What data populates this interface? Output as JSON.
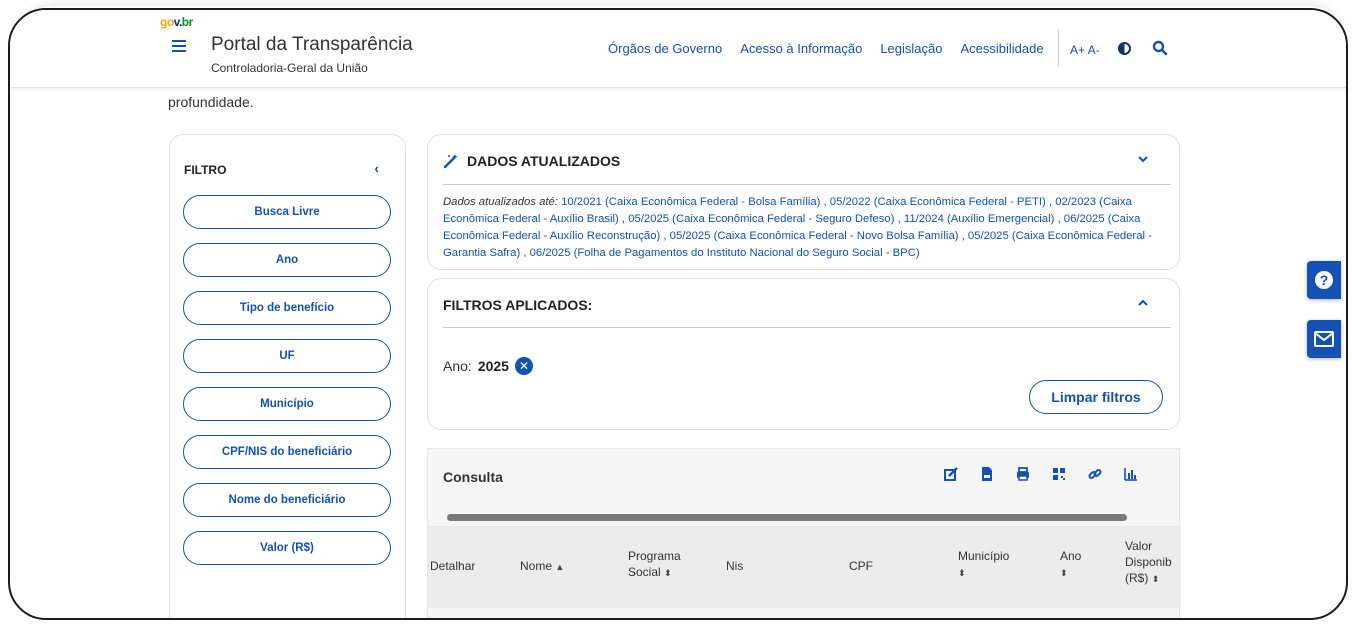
{
  "header": {
    "govbr": {
      "g1": "go",
      "g2": "v.",
      "g3": "br"
    },
    "title": "Portal da Transparência",
    "subtitle": "Controladoria-Geral da União",
    "nav": [
      "Órgãos de Governo",
      "Acesso à Informação",
      "Legislação",
      "Acessibilidade"
    ],
    "font_controls": "A+ A-"
  },
  "lead_text": "profundidade.",
  "sidebar": {
    "title": "FILTRO",
    "collapse": "‹",
    "items": [
      "Busca Livre",
      "Ano",
      "Tipo de benefício",
      "UF",
      "Município",
      "CPF/NIS do beneficiário",
      "Nome do beneficiário",
      "Valor (R$)"
    ]
  },
  "dados": {
    "title": "DADOS ATUALIZADOS",
    "prefix": "Dados atualizados até:",
    "text": " 10/2021 (Caixa Econômica Federal - Bolsa Família) , 05/2022 (Caixa Econômica Federal - PETI) , 02/2023 (Caixa Econômica Federal - Auxílio Brasil) , 05/2025 (Caixa Econômica Federal - Seguro Defeso) , 11/2024 (Auxílio Emergencial) , 06/2025 (Caixa Econômica Federal - Auxílio Reconstrução) , 05/2025 (Caixa Econômica Federal - Novo Bolsa Família) , 05/2025 (Caixa Econômica Federal - Garantia Safra) , 06/2025 (Folha de Pagamentos do Instituto Nacional do Seguro Social - BPC)"
  },
  "filtros": {
    "title": "FILTROS APLICADOS:",
    "applied_label": "Ano:",
    "applied_value": "2025",
    "clear_button": "Limpar filtros"
  },
  "consulta": {
    "title": "Consulta",
    "tool_icons": [
      "edit-icon",
      "csv-icon",
      "print-icon",
      "qrcode-icon",
      "link-icon",
      "chart-icon"
    ],
    "columns": [
      "Detalhar",
      "Nome",
      "Programa Social",
      "Nis",
      "CPF",
      "Município",
      "Ano",
      "Valor Disponib (R$)"
    ]
  },
  "colors": {
    "accent": "#1351b4",
    "text": "#333333"
  }
}
